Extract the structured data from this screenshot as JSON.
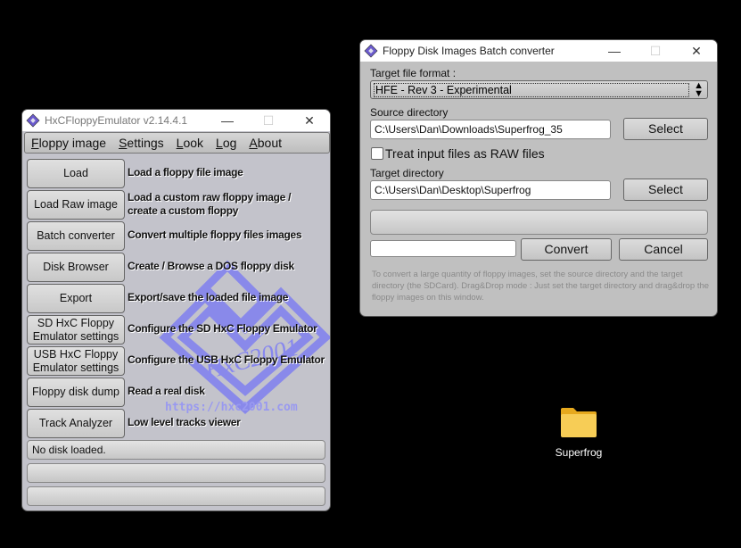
{
  "main_window": {
    "title": "HxCFloppyEmulator v2.14.4.1",
    "controls": {
      "minimize": "—",
      "maximize": "☐",
      "close": "✕"
    },
    "menu": [
      {
        "label": "Floppy image",
        "accel": "F",
        "rest": "loppy image"
      },
      {
        "label": "Settings",
        "accel": "S",
        "rest": "ettings"
      },
      {
        "label": "Look",
        "accel": "L",
        "rest": "ook"
      },
      {
        "label": "Log",
        "accel": "L",
        "rest": "og"
      },
      {
        "label": "About",
        "accel": "A",
        "rest": "bout"
      }
    ],
    "actions": [
      {
        "button": "Load",
        "desc": "Load a floppy file image"
      },
      {
        "button": "Load Raw image",
        "desc": "Load a custom raw floppy image / create a custom floppy"
      },
      {
        "button": "Batch converter",
        "desc": "Convert multiple floppy files images"
      },
      {
        "button": "Disk Browser",
        "desc": "Create / Browse a DOS floppy disk"
      },
      {
        "button": "Export",
        "desc": "Export/save the loaded file image"
      },
      {
        "button": "SD HxC Floppy Emulator settings",
        "desc": "Configure the SD HxC Floppy Emulator"
      },
      {
        "button": "USB HxC Floppy Emulator settings",
        "desc": "Configure the USB HxC Floppy Emulator"
      },
      {
        "button": "Floppy disk dump",
        "desc": "Read a real disk"
      },
      {
        "button": "Track Analyzer",
        "desc": "Low level tracks viewer"
      }
    ],
    "watermark_text": "HxC2001",
    "url": "https://hxc2001.com",
    "status_lines": [
      "No disk loaded.",
      "",
      ""
    ]
  },
  "batch_window": {
    "title": "Floppy Disk Images Batch converter",
    "controls": {
      "minimize": "—",
      "maximize": "☐",
      "close": "✕"
    },
    "target_format_label": "Target file format :",
    "target_format_value": "HFE - Rev 3 - Experimental",
    "source_label": "Source directory",
    "source_value": "C:\\Users\\Dan\\Downloads\\Superfrog_35",
    "select_label": "Select",
    "raw_checkbox_label": "Treat input files as RAW files",
    "raw_checked": false,
    "target_label": "Target directory",
    "target_value": "C:\\Users\\Dan\\Desktop\\Superfrog",
    "progress": 0,
    "convert_label": "Convert",
    "cancel_label": "Cancel",
    "help_text": "To convert a large quantity of floppy images, set the source directory and the target directory (the SDCard). Drag&Drop mode : Just set the target directory and drag&drop the floppy images on this window."
  },
  "desktop": {
    "items": [
      {
        "label": "Superfrog",
        "icon": "folder-icon"
      }
    ]
  }
}
